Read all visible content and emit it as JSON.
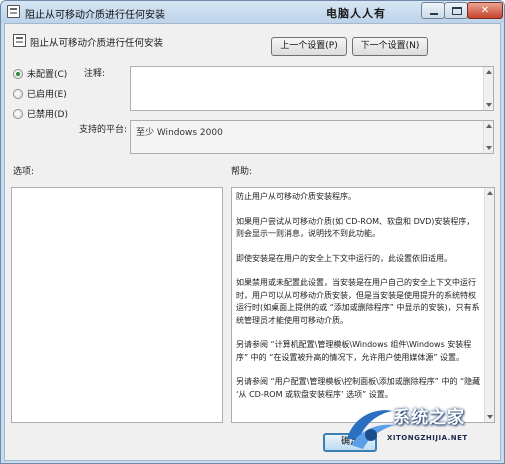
{
  "window": {
    "title": "阻止从可移动介质进行任何安装",
    "watermark": "电脑人人有",
    "controls": {
      "minimize": "─",
      "maximize": "□",
      "close": "✕"
    }
  },
  "header": {
    "policy_title": "阻止从可移动介质进行任何安装",
    "prev_button": "上一个设置(P)",
    "next_button": "下一个设置(N)"
  },
  "state_options": [
    {
      "label": "未配置(C)",
      "selected": true
    },
    {
      "label": "已启用(E)",
      "selected": false
    },
    {
      "label": "已禁用(D)",
      "selected": false
    }
  ],
  "comment": {
    "label": "注释:",
    "value": ""
  },
  "platform": {
    "label": "支持的平台:",
    "value": "至少 Windows 2000"
  },
  "sections": {
    "options_label": "选项:",
    "help_label": "帮助:"
  },
  "help_paragraphs": [
    "防止用户从可移动介质安装程序。",
    "如果用户尝试从可移动介质(如 CD-ROM、软盘和 DVD)安装程序，则会显示一则消息，说明找不到此功能。",
    "即使安装是在用户的安全上下文中运行的，此设置依旧适用。",
    "如果禁用或未配置此设置，当安装是在用户自己的安全上下文中运行时，用户可以从可移动介质安装，但是当安装是使用提升的系统特权运行时(如桌面上提供的或 “添加或删除程序” 中显示的安装)，只有系统管理员才能使用可移动介质。",
    "另请参阅 “计算机配置\\管理模板\\Windows 组件\\Windows 安装程序” 中的 “在设置被升高的情况下，允许用户使用媒体源” 设置。",
    "另请参阅 “用户配置\\管理模板\\控制面板\\添加或删除程序” 中的 “隐藏 ‘从 CD-ROM 或软盘安装程序’ 选项” 设置。"
  ],
  "footer": {
    "ok_button": "确定"
  },
  "logo": {
    "title": "系统之家",
    "subtitle": "XITONGZHIJIA.NET"
  },
  "colors": {
    "title_bar": "#c6dbef",
    "client_bg": "#f0f0f0",
    "close_button": "#c6432a",
    "radio_selected": "#2a8a3c"
  }
}
